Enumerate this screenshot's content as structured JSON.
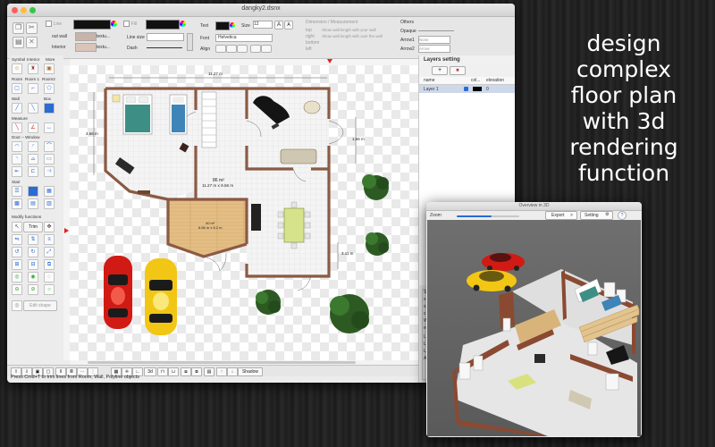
{
  "window": {
    "title": "dangky2.dsnx"
  },
  "toolbar": {
    "line_label": "Line",
    "fill_label": "Fill",
    "text_label": "Text",
    "size_label": "Size",
    "size_value": "12",
    "out_wall_label": "out wall",
    "interior_label": "Interior",
    "out_wall_value": "textu...",
    "interior_value": "textu...",
    "line_size_label": "Line size",
    "dash_label": "Dash",
    "font_label": "Font",
    "font_value": "Helvetica",
    "align_label": "Align",
    "dimension_header": "Dimension / Measurement",
    "dim_top": "top",
    "dim_right": "right",
    "dim_bottom": "bottom",
    "dim_left": "left",
    "dim_opt1": "Show wall length with your wall",
    "dim_opt2": "Show wall length with over the wall",
    "others_header": "Others",
    "opaque_label": "Opaque",
    "arrow1_label": "Arrow1",
    "arrow1_value": "None",
    "arrow2_label": "Arrow2",
    "arrow2_value": "Arrow"
  },
  "palette": {
    "cat_symbol": "Symbol",
    "cat_interior": "Interior",
    "cat_more": "More",
    "cat_room": "Room",
    "cat_room1": "Room 1",
    "cat_room2": "Room2",
    "cat_wall": "Wall",
    "cat_box": "Box",
    "cat_measure": "Measure",
    "cat_door": "Door – Window",
    "cat_stair": "Stair",
    "cat_modify": "Modify functions",
    "trim_label": "Trim",
    "edit_shape_label": "Edit shape"
  },
  "canvas": {
    "dim_top": "11.27 m",
    "dim_left": "4.66 m",
    "dim_right": "1.66 m",
    "dim_right2": "3.11 m",
    "hall_area": "86 m²",
    "hall_size": "11.27 m x 9.56 m",
    "room_area": "40 m²",
    "room_size": "6.66 m x 6.2 m"
  },
  "bottombar": {
    "btn_3d": "3d",
    "shadow_label": "Shadow",
    "status_text": "Press Cmd+T to trim lines from Room, Wall, Polyline objects"
  },
  "layers": {
    "header": "Layers setting",
    "add": "+",
    "remove": "✖",
    "col_name": "name",
    "col_color": "col...",
    "col_elevation": "elevation",
    "row_name": "Layer 1",
    "row_elevation": "0"
  },
  "inspector": {
    "header": "Size",
    "row_x1": "x1",
    "row_x2": "x2",
    "row_cx": "cX",
    "row_w": "W...",
    "row_ele": "ele...",
    "row_len1": "Len",
    "row_len2": "Len",
    "row_len3": "Len",
    "row_angle": "Angl"
  },
  "overview": {
    "title": "Overview in 3D",
    "zoom_label": "Zoom",
    "zoom_level": 0.55,
    "export_label": "Export",
    "setting_label": "Setting",
    "help_label": "?"
  },
  "promo": {
    "line1": "design",
    "line2": "complex",
    "line3": "floor plan",
    "line4": "with 3d",
    "line5": "rendering",
    "line6": "function"
  },
  "colors": {
    "wall": "#8b5a44",
    "accent": "#2a6bd4",
    "car_red": "#d11a14",
    "car_yellow": "#f2c615",
    "tree": "#2d5a23"
  }
}
